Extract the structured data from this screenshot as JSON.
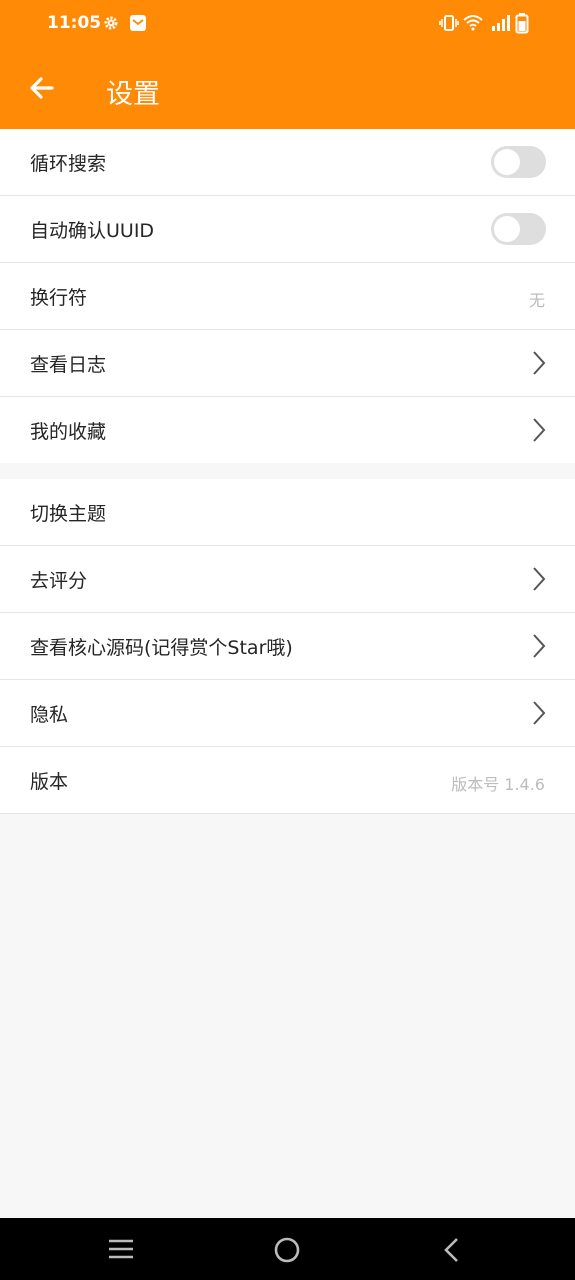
{
  "status_bar": {
    "time": "11:05",
    "icons": [
      "gear-icon",
      "mail-icon",
      "vibrate-icon",
      "wifi-icon",
      "signal-icon",
      "battery-icon"
    ]
  },
  "app_bar": {
    "title": "设置"
  },
  "colors": {
    "accent": "#ff8a05",
    "toggle_off": "#dedede"
  },
  "groups": [
    {
      "items": [
        {
          "label": "循环搜索",
          "control": "toggle",
          "state": "off"
        },
        {
          "label": "自动确认UUID",
          "control": "toggle",
          "state": "off"
        },
        {
          "label": "换行符",
          "control": "value",
          "value": "无"
        },
        {
          "label": "查看日志",
          "control": "chevron"
        },
        {
          "label": "我的收藏",
          "control": "chevron"
        }
      ]
    },
    {
      "items": [
        {
          "label": "切换主题",
          "control": "none"
        },
        {
          "label": "去评分",
          "control": "chevron"
        },
        {
          "label": "查看核心源码(记得赏个Star哦)",
          "control": "chevron"
        },
        {
          "label": "隐私",
          "control": "chevron"
        },
        {
          "label": "版本",
          "control": "value",
          "value": "版本号 1.4.6"
        }
      ]
    }
  ],
  "nav_bar": {
    "icons": [
      "menu-icon",
      "home-icon",
      "back-nav-icon"
    ]
  }
}
